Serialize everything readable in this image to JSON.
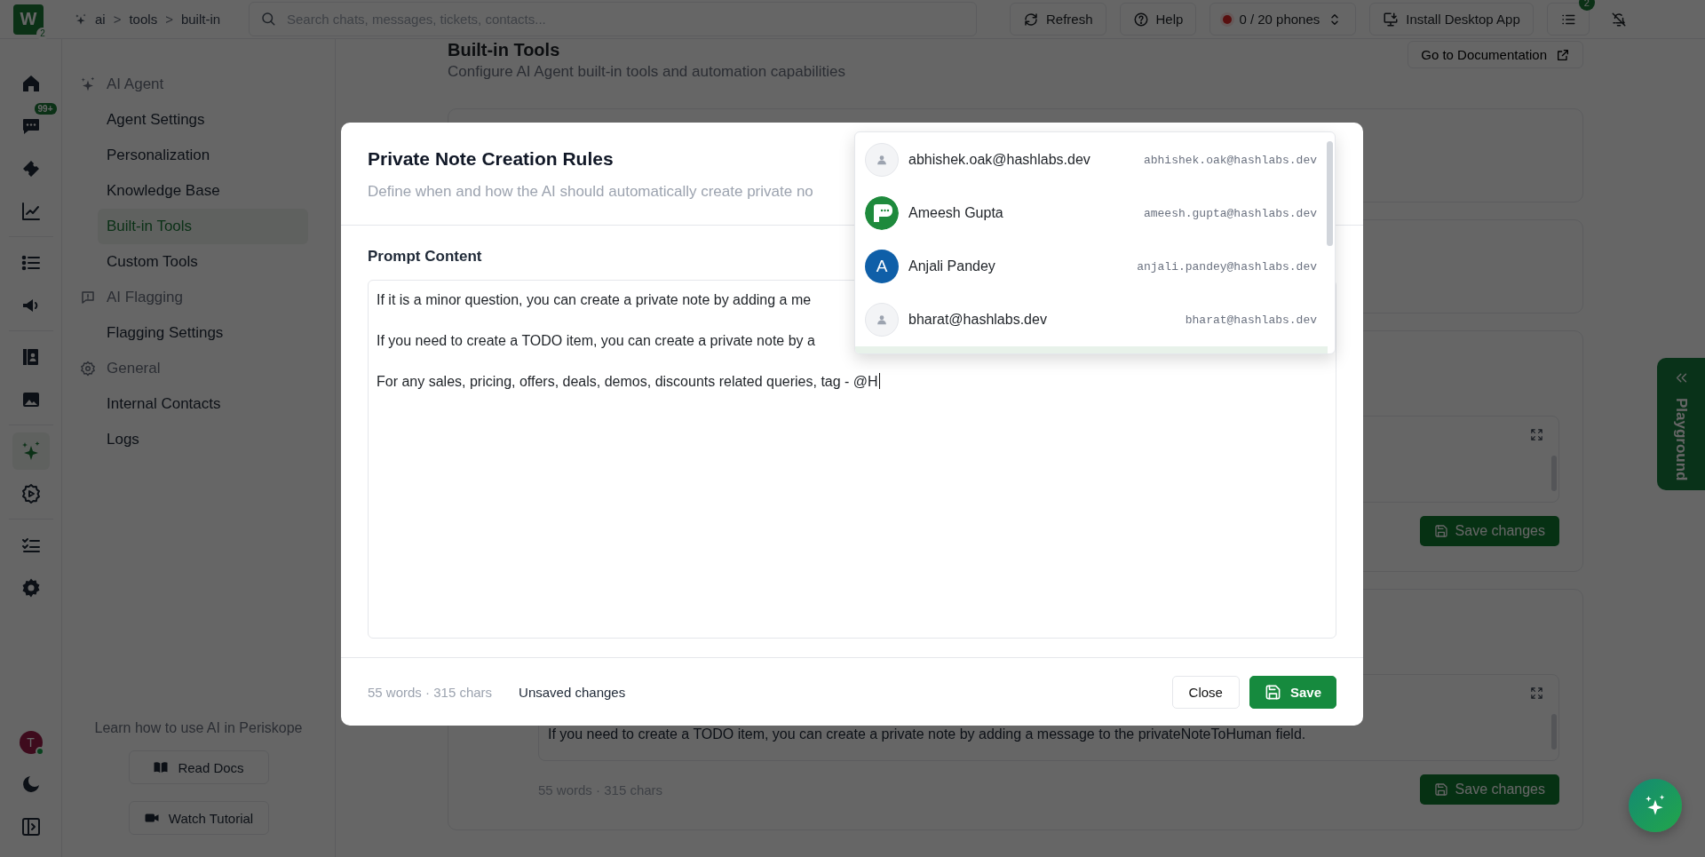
{
  "topbar": {
    "logo": "W",
    "logo_badge": "2",
    "breadcrumb": [
      "ai",
      "tools",
      "built-in"
    ],
    "separator": ">",
    "search": {
      "placeholder": "Search chats, messages, tickets, contacts..."
    },
    "buttons": [
      {
        "kind": "refresh",
        "label": "Refresh"
      },
      {
        "kind": "help",
        "label": "Help"
      },
      {
        "kind": "phones",
        "label": "0 / 20 phones"
      },
      {
        "kind": "install",
        "label": "Install Desktop App"
      }
    ],
    "tasks_badge": "2"
  },
  "rail": {
    "items": [
      {
        "kind": "home",
        "selected": false
      },
      {
        "kind": "chat",
        "selected": false,
        "badge": "99+"
      },
      {
        "kind": "ticket",
        "selected": false
      },
      {
        "kind": "chart",
        "selected": false,
        "divider_after": true
      },
      {
        "kind": "list",
        "selected": false
      },
      {
        "kind": "megaphone",
        "selected": false,
        "divider_after": true
      },
      {
        "kind": "contacts",
        "selected": false
      },
      {
        "kind": "image",
        "selected": false,
        "divider_after": true
      },
      {
        "kind": "sparkle",
        "selected": true
      },
      {
        "kind": "gearplay",
        "selected": false,
        "divider_after": true
      },
      {
        "kind": "checklist",
        "selected": false
      },
      {
        "kind": "gear",
        "selected": false
      }
    ],
    "avatar": {
      "initial": "T",
      "online": true
    }
  },
  "sidebar": {
    "sections": [
      {
        "kind": "sparkle",
        "title": "AI Agent",
        "items": [
          {
            "label": "Agent Settings",
            "selected": false
          },
          {
            "label": "Personalization",
            "selected": false
          },
          {
            "label": "Knowledge Base",
            "selected": false
          },
          {
            "label": "Built-in Tools",
            "selected": true
          },
          {
            "label": "Custom Tools",
            "selected": false
          }
        ]
      },
      {
        "kind": "flag",
        "title": "AI Flagging",
        "items": [
          {
            "label": "Flagging Settings",
            "selected": false
          }
        ]
      },
      {
        "kind": "cog",
        "title": "General",
        "items": [
          {
            "label": "Internal Contacts",
            "selected": false
          },
          {
            "label": "Logs",
            "selected": false
          }
        ]
      }
    ],
    "help_text": "Learn how to use AI in Periskope",
    "buttons": [
      {
        "kind": "docs",
        "label": "Read Docs"
      },
      {
        "kind": "video",
        "label": "Watch Tutorial"
      }
    ]
  },
  "page": {
    "title": "Built-in Tools",
    "subtitle": "Configure AI Agent built-in tools and automation capabilities",
    "doc_button": "Go to Documentation",
    "cards": [
      {
        "kind": "empty"
      },
      {
        "kind": "empty"
      },
      {
        "kind": "editor",
        "save_button": "Save changes"
      },
      {
        "kind": "editor",
        "text": "If you need to create a TODO item, you can create a private note by adding a message to the privateNoteToHuman field.",
        "counter": "55 words · 315 chars",
        "save_button": "Save changes"
      }
    ]
  },
  "playground_tab": "Playground",
  "modal": {
    "title": "Private Note Creation Rules",
    "subtitle": "Define when and how the AI should automatically create private no",
    "field_label": "Prompt Content",
    "lines": [
      "If it is a minor question, you can create a private note by adding a me",
      "If you need to create a TODO item, you can create a private note by a",
      "For any sales, pricing, offers, deals, demos, discounts related queries, tag - @H"
    ],
    "counter": "55 words · 315 chars",
    "status": "Unsaved changes",
    "buttons": [
      {
        "kind": "secondary",
        "label": "Close"
      },
      {
        "kind": "primary",
        "label": "Save"
      }
    ]
  },
  "mention_menu": {
    "items": [
      {
        "name": "abhishek.oak@hashlabs.dev",
        "email": "abhishek.oak@hashlabs.dev",
        "kind": "placeholder",
        "selected": false
      },
      {
        "name": "Ameesh Gupta",
        "email": "ameesh.gupta@hashlabs.dev",
        "kind": "logo",
        "selected": false
      },
      {
        "name": "Anjali Pandey",
        "email": "anjali.pandey@hashlabs.dev",
        "kind": "initial",
        "initial": "A",
        "selected": false
      },
      {
        "name": "bharat@hashlabs.dev",
        "email": "bharat@hashlabs.dev",
        "kind": "placeholder",
        "selected": false
      },
      {
        "selected": true
      }
    ]
  }
}
